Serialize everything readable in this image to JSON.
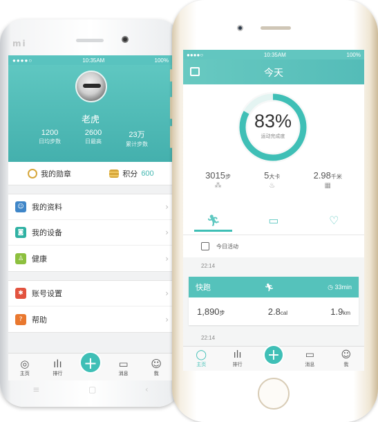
{
  "android": {
    "brand": "mi",
    "status": {
      "time": "10:35AM",
      "battery": "100%"
    },
    "profile": {
      "name": "老虎",
      "stats": [
        {
          "value": "1200",
          "label": "日均步数"
        },
        {
          "value": "2600",
          "label": "日最高"
        },
        {
          "value": "23万",
          "label": "累计步数"
        }
      ]
    },
    "badges": {
      "medals": "我的勋章",
      "points_label": "积分",
      "points_value": "600"
    },
    "menu_group1": [
      {
        "label": "我的资料",
        "icon": "profile-icon",
        "color": "#3f86c8"
      },
      {
        "label": "我的设备",
        "icon": "watch-icon",
        "color": "#2fb1a3"
      },
      {
        "label": "健康",
        "icon": "person-icon",
        "color": "#8dc03f"
      }
    ],
    "menu_group2": [
      {
        "label": "账号设置",
        "icon": "gear-icon",
        "color": "#e2533f"
      },
      {
        "label": "帮助",
        "icon": "help-icon",
        "color": "#e9782f"
      }
    ],
    "tabs": [
      {
        "label": "主页",
        "icon": "home-ring-icon"
      },
      {
        "label": "排行",
        "icon": "bars-icon"
      },
      {
        "label": "",
        "icon": "plus-icon"
      },
      {
        "label": "消息",
        "icon": "message-icon"
      },
      {
        "label": "我",
        "icon": "user-icon"
      }
    ]
  },
  "iphone": {
    "status": {
      "time": "10:35AM",
      "battery": "100%"
    },
    "header_title": "今天",
    "progress": {
      "value": 83,
      "text": "83%",
      "caption": "运动完成度"
    },
    "metrics": [
      {
        "value": "3015",
        "unit": "步",
        "icon": "footsteps-icon"
      },
      {
        "value": "5",
        "unit": "大卡",
        "icon": "flame-icon"
      },
      {
        "value": "2.98",
        "unit": "千米",
        "icon": "map-icon"
      }
    ],
    "modes": [
      "run-icon",
      "bed-icon",
      "heart-icon"
    ],
    "today_label": "今日活动",
    "entries": [
      {
        "time": "22:14",
        "activity": "快跑",
        "duration": "33min",
        "steps": "1,890",
        "steps_unit": "步",
        "cal": "2.8",
        "cal_unit": "cal",
        "dist": "1.9",
        "dist_unit": "km"
      }
    ],
    "next_time": "22:14",
    "tabs": [
      {
        "label": "主页",
        "icon": "home-ring-icon"
      },
      {
        "label": "排行",
        "icon": "bars-icon"
      },
      {
        "label": "",
        "icon": "plus-icon"
      },
      {
        "label": "消息",
        "icon": "message-icon"
      },
      {
        "label": "我",
        "icon": "user-icon"
      }
    ]
  },
  "colors": {
    "accent": "#3fbfb6",
    "header": "#5fc7c1"
  }
}
